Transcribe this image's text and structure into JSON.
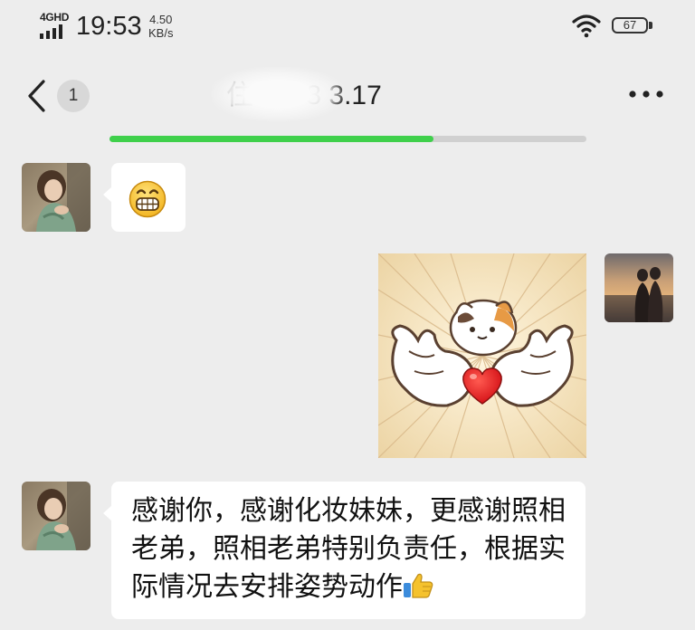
{
  "status_bar": {
    "network": "4GHD",
    "time": "19:53",
    "speed_value": "4.50",
    "speed_unit": "KB/s",
    "battery": "67",
    "icons": [
      "signal-icon",
      "wifi-icon",
      "battery-icon"
    ]
  },
  "nav": {
    "back_icon": "chevron-left-icon",
    "unread_count": "1",
    "title": "住 1988 3.17",
    "more_icon": "more-dots-icon"
  },
  "load_progress": 0.68,
  "messages": [
    {
      "side": "left",
      "type": "emoji",
      "content": "grinning-face-emoji"
    },
    {
      "side": "right",
      "type": "sticker",
      "content": "cat-heart-hands-sticker"
    },
    {
      "side": "left",
      "type": "text",
      "text": "感谢你，感谢化妆妹妹，更感谢照相老弟，照相老弟特别负责任，根据实际情况去安排姿势动作",
      "trailing_emoji": "thumbs-up-emoji"
    }
  ],
  "colors": {
    "background": "#ededed",
    "bubble": "#ffffff",
    "accent_green": "#3fd04b",
    "sticker_bg": "#f4e6c8",
    "heart": "#e8151b"
  }
}
